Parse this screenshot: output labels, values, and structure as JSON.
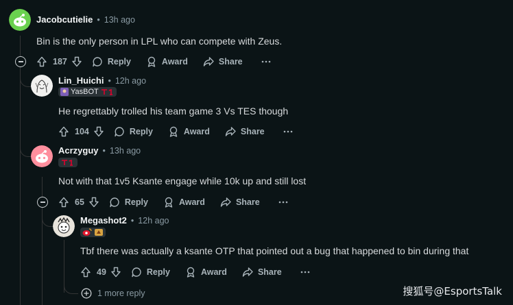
{
  "comments": [
    {
      "author": "Jacobcutielie",
      "time": "13h ago",
      "body": "Bin is the only person in LPL who can compete with Zeus.",
      "votes": "187",
      "reply": "Reply",
      "award": "Award",
      "share": "Share",
      "avatar_color": "#6ad14f"
    },
    {
      "author": "Lin_Huichi",
      "time": "12h ago",
      "flair_text": "YasBOT",
      "body": "He regrettably trolled his team game 3 Vs TES though",
      "votes": "104",
      "reply": "Reply",
      "award": "Award",
      "share": "Share"
    },
    {
      "author": "Acrzyguy",
      "time": "13h ago",
      "body": "Not with that 1v5 Ksante engage while 10k up and still lost",
      "votes": "65",
      "reply": "Reply",
      "award": "Award",
      "share": "Share",
      "avatar_color": "#ff8f9e"
    },
    {
      "author": "Megashot2",
      "time": "12h ago",
      "body": "Tbf there was actually a ksante OTP that pointed out a bug that happened to bin during that",
      "votes": "49",
      "reply": "Reply",
      "award": "Award",
      "share": "Share"
    }
  ],
  "more_replies": "1 more reply",
  "separator": "•",
  "watermark": "搜狐号@EsportsTalk",
  "colors": {
    "background": "#0b1416",
    "text": "#d7dadc",
    "meta": "#8a9aa3",
    "line": "#343536"
  }
}
